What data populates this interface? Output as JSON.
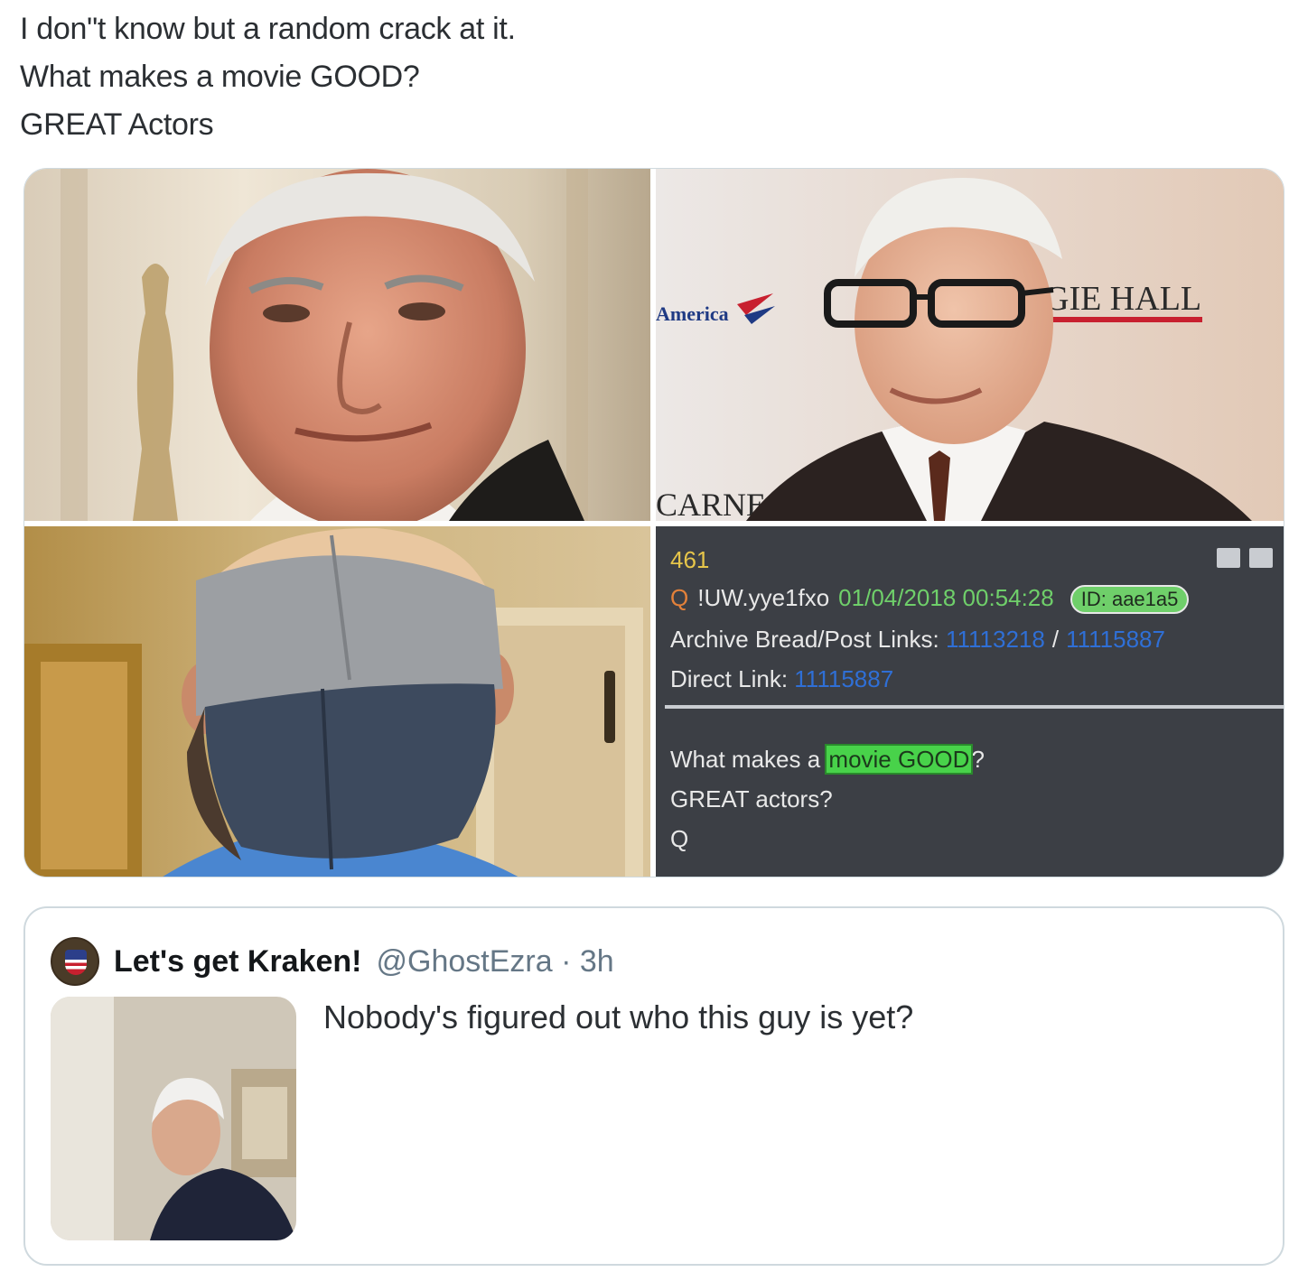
{
  "tweet": {
    "lines": [
      "I don\"t know but a random crack at it.",
      "What makes a movie GOOD?",
      "GREAT Actors"
    ]
  },
  "media": {
    "photo_sign_left": "America",
    "photo_sign_right": "GIE HALL",
    "photo_sign_bottom": "CARNE",
    "qpost": {
      "number": "461",
      "q_label": "Q",
      "tripcode": "!UW.yye1fxo",
      "datetime": "01/04/2018 00:54:28",
      "id_badge": "ID: aae1a5",
      "archive_label": "Archive Bread/Post Links:",
      "archive_link_1": "11113218",
      "archive_sep": "/",
      "archive_link_2": "11115887",
      "direct_label": "Direct Link:",
      "direct_link": "11115887",
      "body_prefix": "What makes a ",
      "body_highlight": "movie GOOD",
      "body_suffix": "?",
      "body_line2": "GREAT actors?",
      "body_line3": "Q"
    }
  },
  "quoted_tweet": {
    "display_name": "Let's get Kraken!",
    "handle_time": "@GhostEzra · 3h",
    "text": "Nobody's figured out who this guy is yet?"
  },
  "colors": {
    "q_number": "#e6c54a",
    "q_date": "#6fcf6a",
    "q_link": "#2f6fd6",
    "q_highlight": "#48d24a",
    "board_bg": "#3c3f45"
  }
}
